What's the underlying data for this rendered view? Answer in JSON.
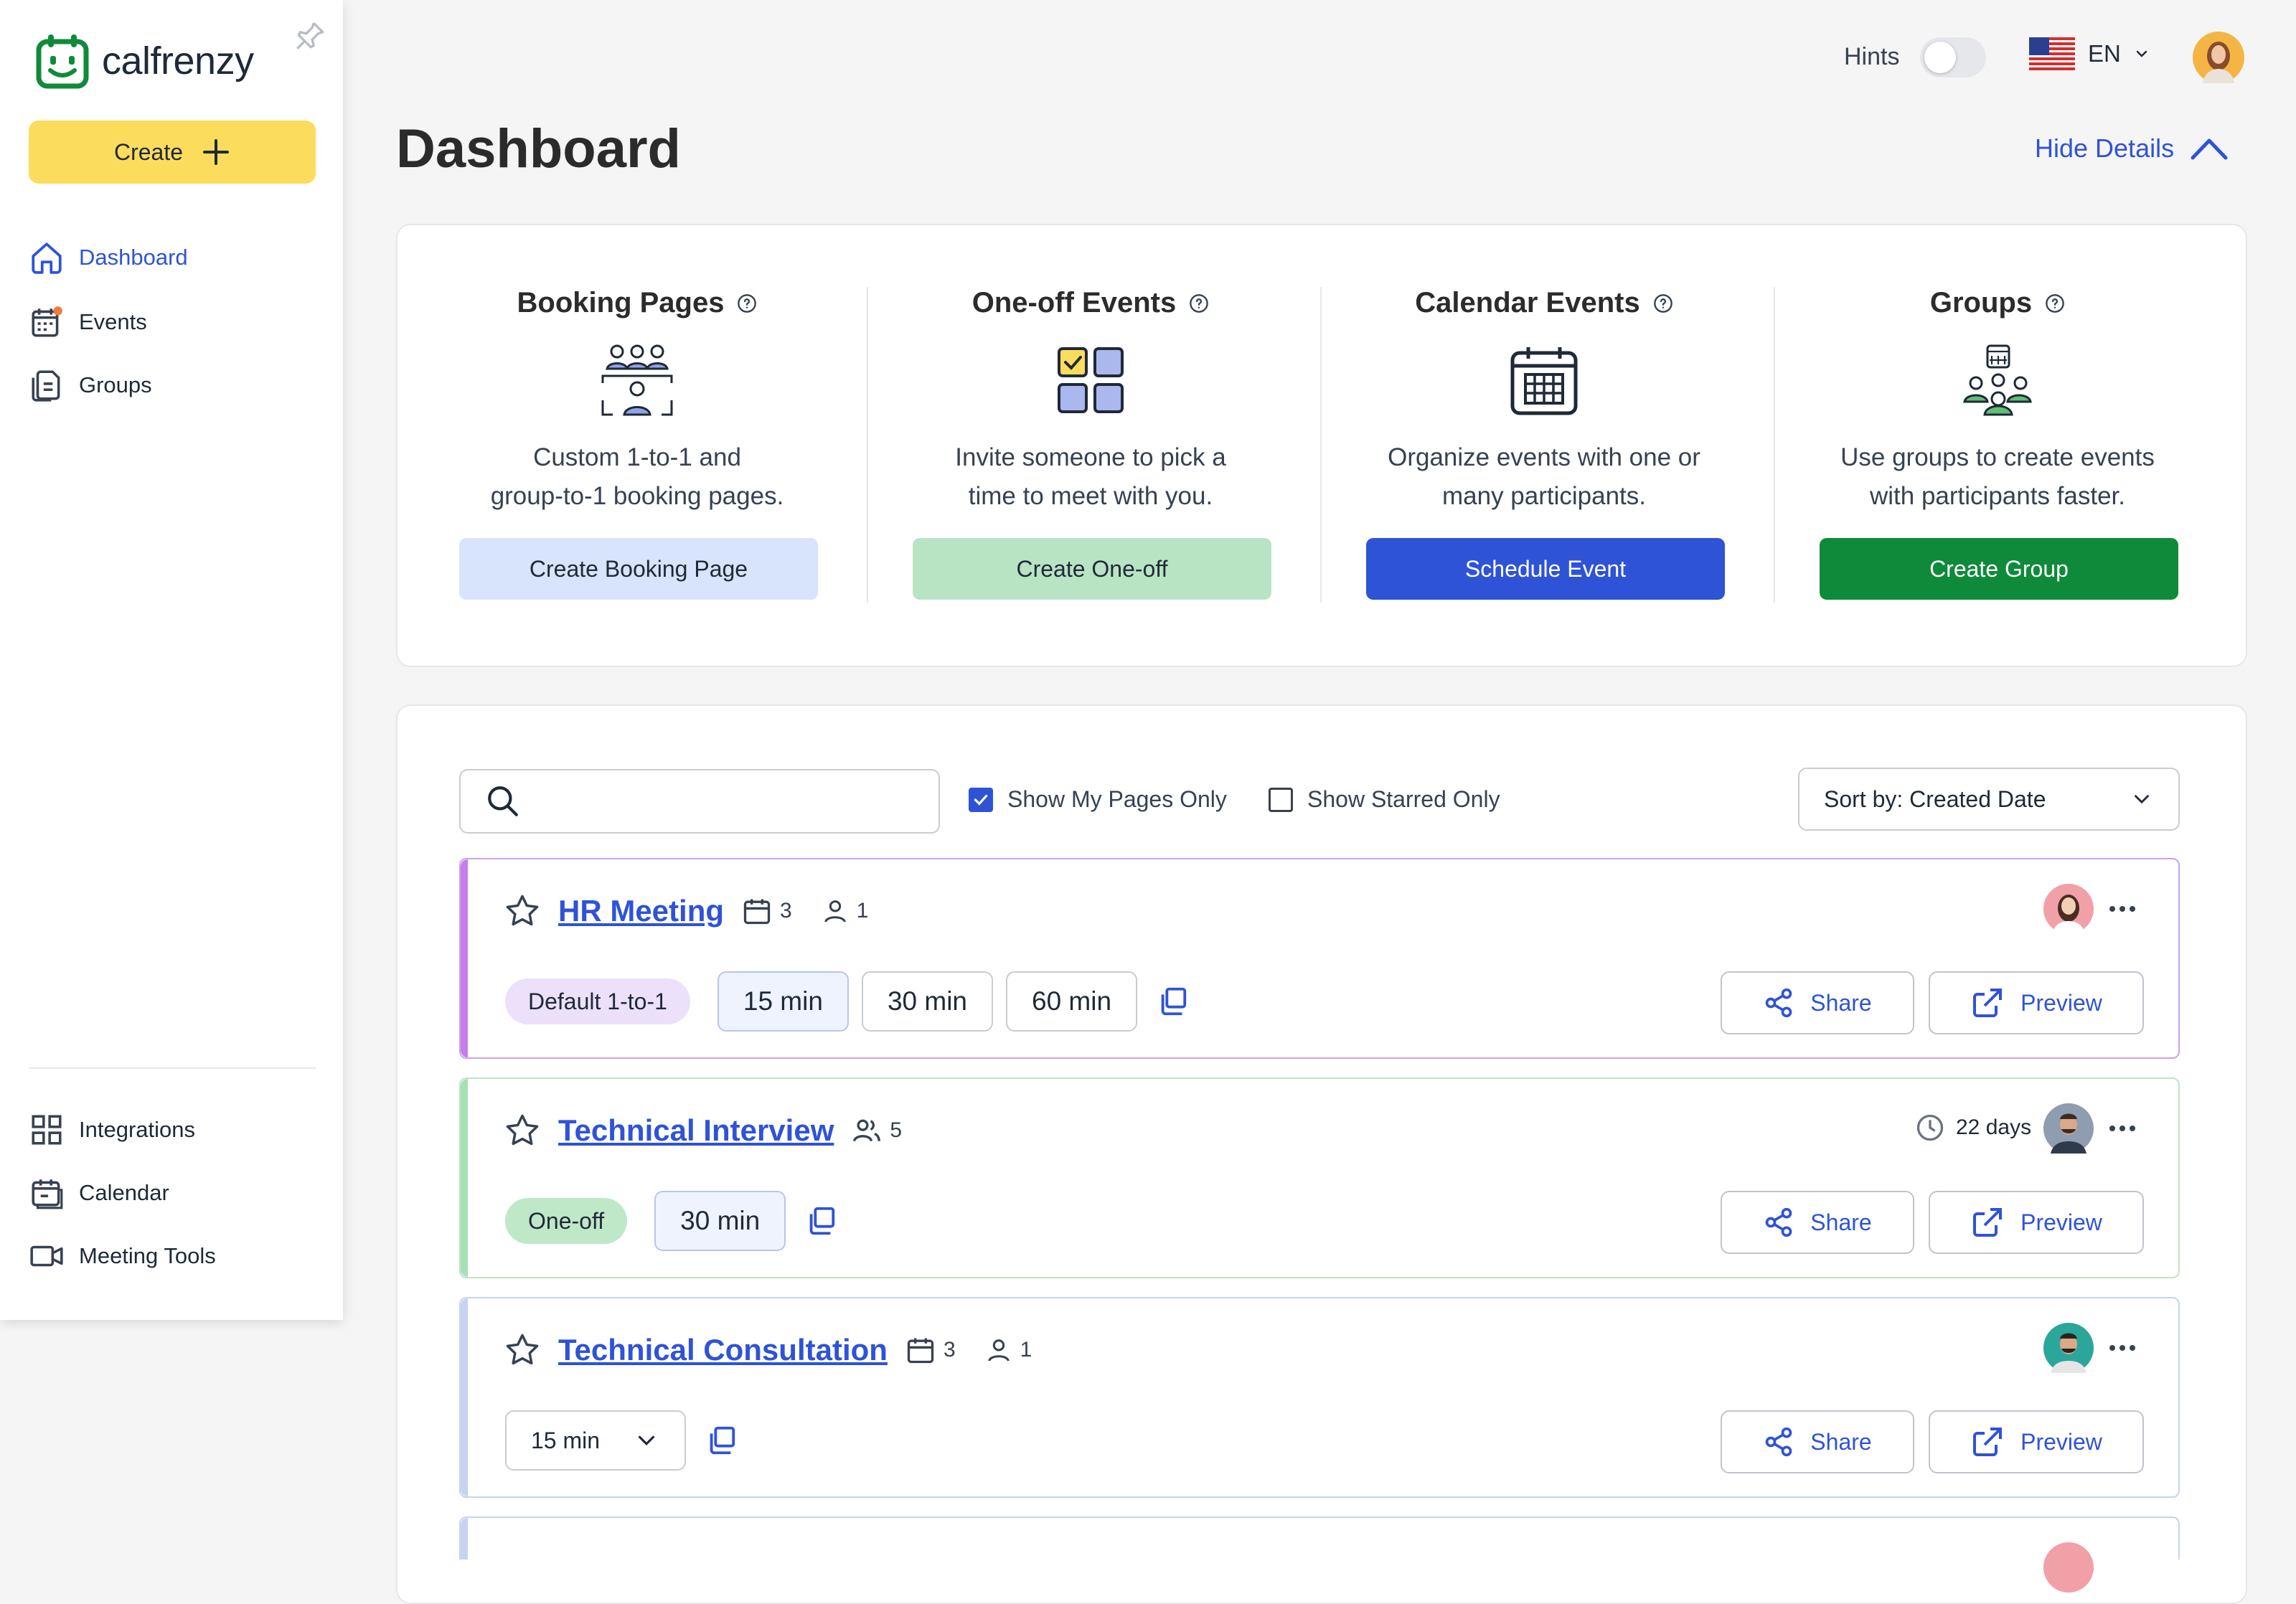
{
  "app": {
    "name": "calfrenzy"
  },
  "sidebar": {
    "create_label": "Create",
    "items": [
      {
        "label": "Dashboard",
        "icon": "home-icon",
        "active": true
      },
      {
        "label": "Events",
        "icon": "calendar-icon"
      },
      {
        "label": "Groups",
        "icon": "groups-icon"
      }
    ],
    "bottom_items": [
      {
        "label": "Integrations",
        "icon": "grid-icon"
      },
      {
        "label": "Calendar",
        "icon": "calendar-icon"
      },
      {
        "label": "Meeting Tools",
        "icon": "video-icon"
      }
    ]
  },
  "topbar": {
    "hints_label": "Hints",
    "hints_on": false,
    "language": "EN"
  },
  "header": {
    "title": "Dashboard",
    "hide_details": "Hide Details"
  },
  "details": [
    {
      "title": "Booking Pages",
      "desc_line1": "Custom 1-to-1 and",
      "desc_line2": "group-to-1 booking pages.",
      "button": "Create Booking Page",
      "btn_bg": "#d8e3fc",
      "btn_fg": "#1f2937"
    },
    {
      "title": "One-off Events",
      "desc_line1": "Invite someone to pick a",
      "desc_line2": "time to meet with you.",
      "button": "Create One-off",
      "btn_bg": "#b9e4c3",
      "btn_fg": "#1f2937"
    },
    {
      "title": "Calendar Events",
      "desc_line1": "Organize events with one or",
      "desc_line2": "many participants.",
      "button": "Schedule Event",
      "btn_bg": "#2f53d6",
      "btn_fg": "#ffffff"
    },
    {
      "title": "Groups",
      "desc_line1": "Use groups to create events",
      "desc_line2": "with participants faster.",
      "button": "Create Group",
      "btn_bg": "#0f8a3a",
      "btn_fg": "#ffffff"
    }
  ],
  "filters": {
    "search_value": "",
    "show_my_pages": {
      "label": "Show My Pages Only",
      "checked": true
    },
    "show_starred": {
      "label": "Show Starred Only",
      "checked": false
    },
    "sort_label": "Sort by: Created Date"
  },
  "cards": [
    {
      "title": "HR Meeting",
      "accent": "#c77dea",
      "calendar_count": "3",
      "people_count": "1",
      "type": "Default 1-to-1",
      "durations": [
        "15 min",
        "30 min",
        "60 min"
      ],
      "share": "Share",
      "preview": "Preview"
    },
    {
      "title": "Technical Interview",
      "accent": "#a8e0b5",
      "group_count": "5",
      "expires": "22 days",
      "type": "One-off",
      "durations": [
        "30 min"
      ],
      "share": "Share",
      "preview": "Preview"
    },
    {
      "title": "Technical Consultation",
      "accent": "#c7d3f3",
      "calendar_count": "3",
      "people_count": "1",
      "duration_select": "15 min",
      "share": "Share",
      "preview": "Preview"
    }
  ]
}
